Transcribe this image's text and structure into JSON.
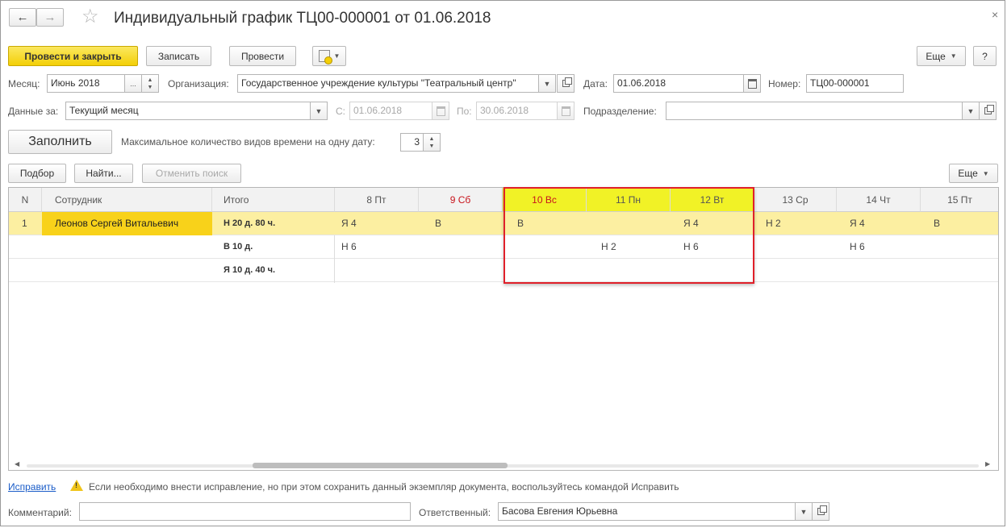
{
  "window": {
    "title": "Индивидуальный график ТЦ00-000001 от 01.06.2018",
    "close_icon": "close-icon"
  },
  "toolbar": {
    "post_close": "Провести и закрыть",
    "save": "Записать",
    "post": "Провести",
    "more": "Еще",
    "help": "?"
  },
  "form": {
    "month_label": "Месяц:",
    "month_value": "Июнь 2018",
    "month_dots": "...",
    "org_label": "Организация:",
    "org_value": "Государственное учреждение культуры \"Театральный центр\"",
    "date_label": "Дата:",
    "date_value": "01.06.2018",
    "number_label": "Номер:",
    "number_value": "ТЦ00-000001",
    "data_for_label": "Данные за:",
    "data_for_value": "Текущий месяц",
    "from_label": "С:",
    "from_value": "01.06.2018",
    "to_label": "По:",
    "to_value": "30.06.2018",
    "division_label": "Подразделение:",
    "division_value": "",
    "fill_button": "Заполнить",
    "max_types_label": "Максимальное количество видов времени на одну дату:",
    "max_types_value": "3"
  },
  "table_toolbar": {
    "pick": "Подбор",
    "find": "Найти...",
    "cancel_search": "Отменить поиск",
    "more": "Еще"
  },
  "table": {
    "headers": {
      "n": "N",
      "employee": "Сотрудник",
      "total": "Итого",
      "days": [
        "8 Пт",
        "9 Сб",
        "10 Вс",
        "11 Пн",
        "12 Вт",
        "13 Ср",
        "14 Чт",
        "15 Пт"
      ]
    },
    "rows": [
      {
        "n": "1",
        "employee": "Леонов Сергей Витальевич",
        "total": "Н 20 д. 80 ч.",
        "days": [
          "Я 4",
          "В",
          "В",
          "",
          "Я 4",
          "Н 2",
          "Я 4",
          "В"
        ]
      },
      {
        "n": "",
        "employee": "",
        "total": "В 10 д.",
        "days": [
          "Н 6",
          "",
          "",
          "Н 2",
          "Н 6",
          "",
          "Н 6",
          ""
        ]
      },
      {
        "n": "",
        "employee": "",
        "total": "Я 10 д. 40 ч.",
        "days": [
          "",
          "",
          "",
          "",
          "",
          "",
          "",
          ""
        ]
      }
    ]
  },
  "footer": {
    "fix_link": "Исправить",
    "fix_message": "Если необходимо внести исправление, но при этом сохранить данный экземпляр документа, воспользуйтесь командой Исправить",
    "comment_label": "Комментарий:",
    "comment_value": "",
    "responsible_label": "Ответственный:",
    "responsible_value": "Басова Евгения Юрьевна"
  },
  "colors": {
    "primary_yellow": "#f3cf07",
    "highlight_yellow": "#f1f226",
    "selected_row": "#fcefa1",
    "weekend_red": "#c8141c",
    "link_blue": "#1a5cc8",
    "annotation_red": "#e0202a"
  }
}
